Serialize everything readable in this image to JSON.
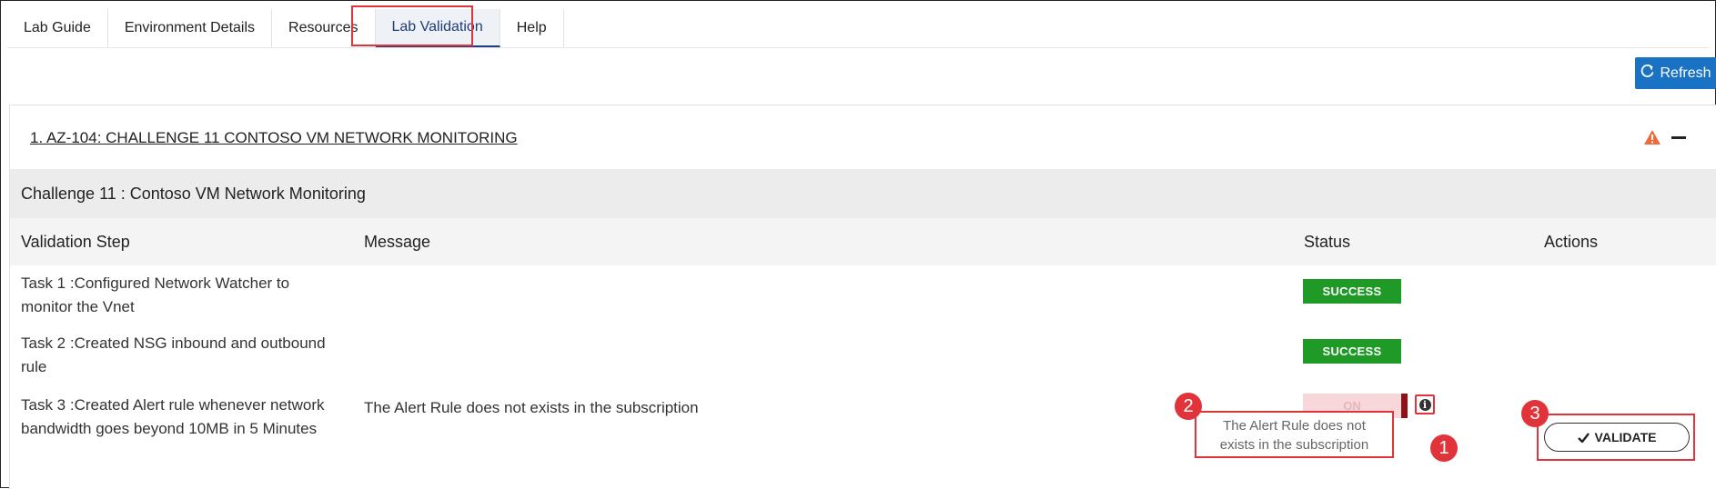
{
  "tabs": [
    {
      "label": "Lab Guide"
    },
    {
      "label": "Environment Details"
    },
    {
      "label": "Resources"
    },
    {
      "label": "Lab Validation"
    },
    {
      "label": "Help"
    }
  ],
  "refresh": {
    "label": "Refresh",
    "icon": "refresh-icon"
  },
  "panel": {
    "title": "1. AZ-104: CHALLENGE 11 CONTOSO VM NETWORK MONITORING",
    "section_title": "Challenge 11 : Contoso VM Network Monitoring"
  },
  "table": {
    "headers": [
      "Validation Step",
      "Message",
      "Status",
      "Actions"
    ],
    "rows": [
      {
        "step_line1": "Task 1 :Configured Network Watcher to",
        "step_line2": "monitor the Vnet",
        "message": "",
        "status": "SUCCESS"
      },
      {
        "step_line1": "Task 2 :Created NSG inbound and outbound",
        "step_line2": "rule",
        "message": "",
        "status": "SUCCESS"
      },
      {
        "step_line1": "Task 3 :Created Alert rule whenever network",
        "step_line2": "bandwidth goes beyond 10MB in 5 Minutes",
        "message": "The Alert Rule does not exists in the subscription",
        "status": "ON"
      }
    ]
  },
  "tooltip": {
    "line1": "The Alert Rule does not",
    "line2": "exists in the subscription"
  },
  "validate": {
    "label": "VALIDATE",
    "icon": "check-icon"
  },
  "callouts": [
    "1",
    "2",
    "3"
  ],
  "colors": {
    "accent_red": "#e0333a",
    "success_green": "#1f9a27",
    "refresh_blue": "#1a72c4",
    "warning_orange": "#f06a3c"
  }
}
